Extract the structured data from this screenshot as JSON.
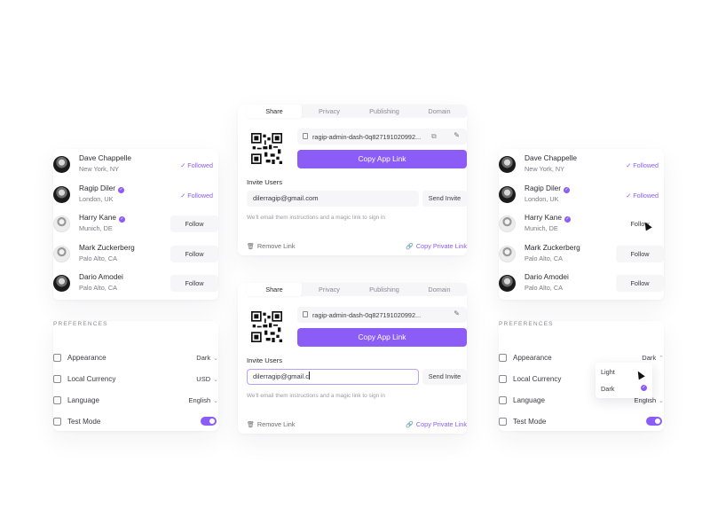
{
  "colors": {
    "accent": "#8b5cf6"
  },
  "people": [
    {
      "name": "Dave Chappelle",
      "location": "New York, NY",
      "verified": false,
      "action": "Followed",
      "followed": true,
      "avatar": "dark"
    },
    {
      "name": "Ragip Diler",
      "location": "London, UK",
      "verified": true,
      "action": "Followed",
      "followed": true,
      "avatar": "dark"
    },
    {
      "name": "Harry Kane",
      "location": "Munich, DE",
      "verified": true,
      "action": "Follow",
      "followed": false,
      "avatar": "light"
    },
    {
      "name": "Mark Zuckerberg",
      "location": "Palo Alto, CA",
      "verified": false,
      "action": "Follow",
      "followed": false,
      "avatar": "light"
    },
    {
      "name": "Dario Amodei",
      "location": "Palo Alto, CA",
      "verified": false,
      "action": "Follow",
      "followed": false,
      "avatar": "dark"
    }
  ],
  "preferences": {
    "title": "PREFERENCES",
    "rows": [
      {
        "label": "Appearance",
        "value": "Dark",
        "icon": "palette-icon"
      },
      {
        "label": "Local Currency",
        "value": "USD",
        "icon": "currency-icon"
      },
      {
        "label": "Language",
        "value": "English",
        "icon": "language-icon"
      },
      {
        "label": "Test Mode",
        "value": "",
        "icon": "test-mode-icon",
        "toggle": true
      }
    ]
  },
  "dropdown": {
    "options": [
      "Light",
      "Dark"
    ],
    "selected": "Dark"
  },
  "share": {
    "tabs": [
      "Share",
      "Privacy",
      "Publishing",
      "Domain"
    ],
    "active_tab": "Share",
    "url": "ragip-admin-dash-0q827191020992...",
    "copy_button": "Copy App Link",
    "invite_label": "Invite Users",
    "email_value_top": "dilerragip@gmail.com",
    "email_value_bottom": "dilerragip@gmail.c",
    "send_button": "Send Invite",
    "hint": "We'll email them instructions and a magic link to sign in",
    "remove_link": "Remove Link",
    "private_link": "Copy Private Link"
  }
}
